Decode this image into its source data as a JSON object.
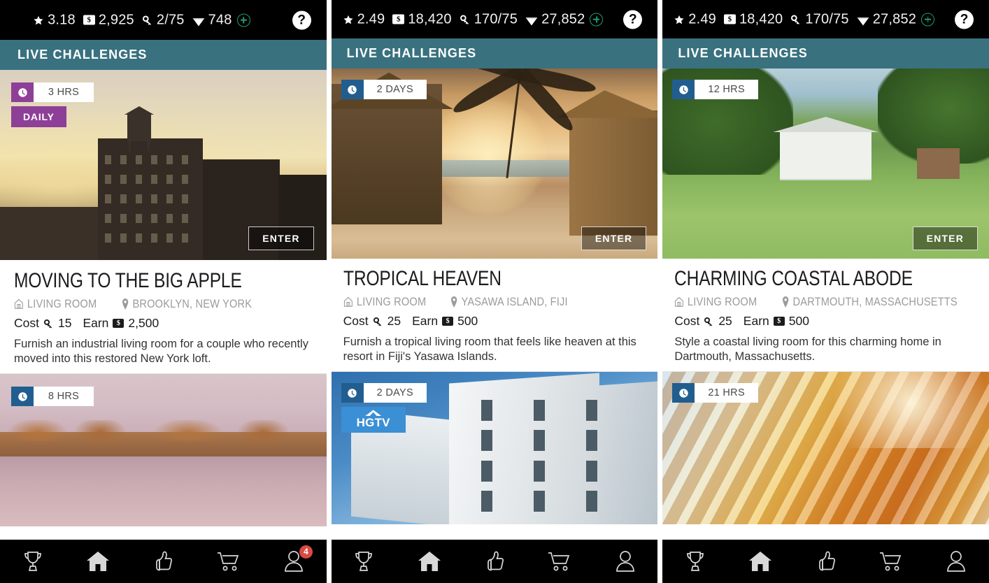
{
  "app": {
    "section_header": "LIVE CHALLENGES",
    "help_label": "?",
    "enter_label": "ENTER",
    "cost_label": "Cost",
    "earn_label": "Earn",
    "accent_teal": "#39717f",
    "accent_purple": "#8e3f97",
    "accent_blue": "#215e8f",
    "hgtv_blue": "#3b8fd4",
    "badge_red": "#d94a45",
    "plus_green": "#1f9e6e"
  },
  "panels": [
    {
      "id": "panel-1",
      "stats": {
        "star": "3.18",
        "money": "2,925",
        "keys": "2/75",
        "gems": "748"
      },
      "cards": [
        {
          "timer": "3 HRS",
          "timer_style": "purple",
          "tag": "DAILY",
          "tag_type": "daily",
          "title": "MOVING TO THE BIG APPLE",
          "room": "LIVING ROOM",
          "location": "BROOKLYN, NEW YORK",
          "cost": "15",
          "earn": "2,500",
          "description": "Furnish an industrial living room for a couple who recently moved into this restored New York loft.",
          "photo": "ph-loft",
          "has_enter": true
        },
        {
          "timer": "8 HRS",
          "timer_style": "blue",
          "tag": null,
          "tag_type": null,
          "title": "",
          "room": "",
          "location": "",
          "cost": "",
          "earn": "",
          "description": "",
          "photo": "ph-lake",
          "has_enter": false
        }
      ],
      "nav_badge": "4"
    },
    {
      "id": "panel-2",
      "stats": {
        "star": "2.49",
        "money": "18,420",
        "keys": "170/75",
        "gems": "27,852"
      },
      "cards": [
        {
          "timer": "2 DAYS",
          "timer_style": "blue",
          "tag": null,
          "tag_type": null,
          "title": "TROPICAL HEAVEN",
          "room": "LIVING ROOM",
          "location": "YASAWA ISLAND, FIJI",
          "cost": "25",
          "earn": "500",
          "description": "Furnish a tropical living room that feels like heaven at this resort in Fiji's Yasawa Islands.",
          "photo": "ph-trop",
          "has_enter": true
        },
        {
          "timer": "2 DAYS",
          "timer_style": "blue",
          "tag": "HGTV",
          "tag_type": "hgtv",
          "title": "",
          "room": "",
          "location": "",
          "cost": "",
          "earn": "",
          "description": "",
          "photo": "ph-apt",
          "has_enter": false
        }
      ],
      "nav_badge": null
    },
    {
      "id": "panel-3",
      "stats": {
        "star": "2.49",
        "money": "18,420",
        "keys": "170/75",
        "gems": "27,852"
      },
      "cards": [
        {
          "timer": "12 HRS",
          "timer_style": "blue",
          "tag": null,
          "tag_type": null,
          "title": "CHARMING COASTAL ABODE",
          "room": "LIVING ROOM",
          "location": "DARTMOUTH, MASSACHUSETTS",
          "cost": "25",
          "earn": "500",
          "description": "Style a coastal living room for this charming home in Dartmouth, Massachusetts.",
          "photo": "ph-lawn",
          "has_enter": true
        },
        {
          "timer": "21 HRS",
          "timer_style": "blue",
          "tag": null,
          "tag_type": null,
          "title": "",
          "room": "",
          "location": "",
          "cost": "",
          "earn": "",
          "description": "",
          "photo": "ph-facade",
          "has_enter": false
        }
      ],
      "nav_badge": null
    }
  ],
  "bottom_nav": [
    {
      "name": "trophy",
      "icon": "trophy-icon",
      "active": false
    },
    {
      "name": "home",
      "icon": "home-icon",
      "active": true
    },
    {
      "name": "likes",
      "icon": "thumbs-up-icon",
      "active": false
    },
    {
      "name": "shop",
      "icon": "cart-icon",
      "active": false
    },
    {
      "name": "profile",
      "icon": "person-icon",
      "active": false
    }
  ]
}
